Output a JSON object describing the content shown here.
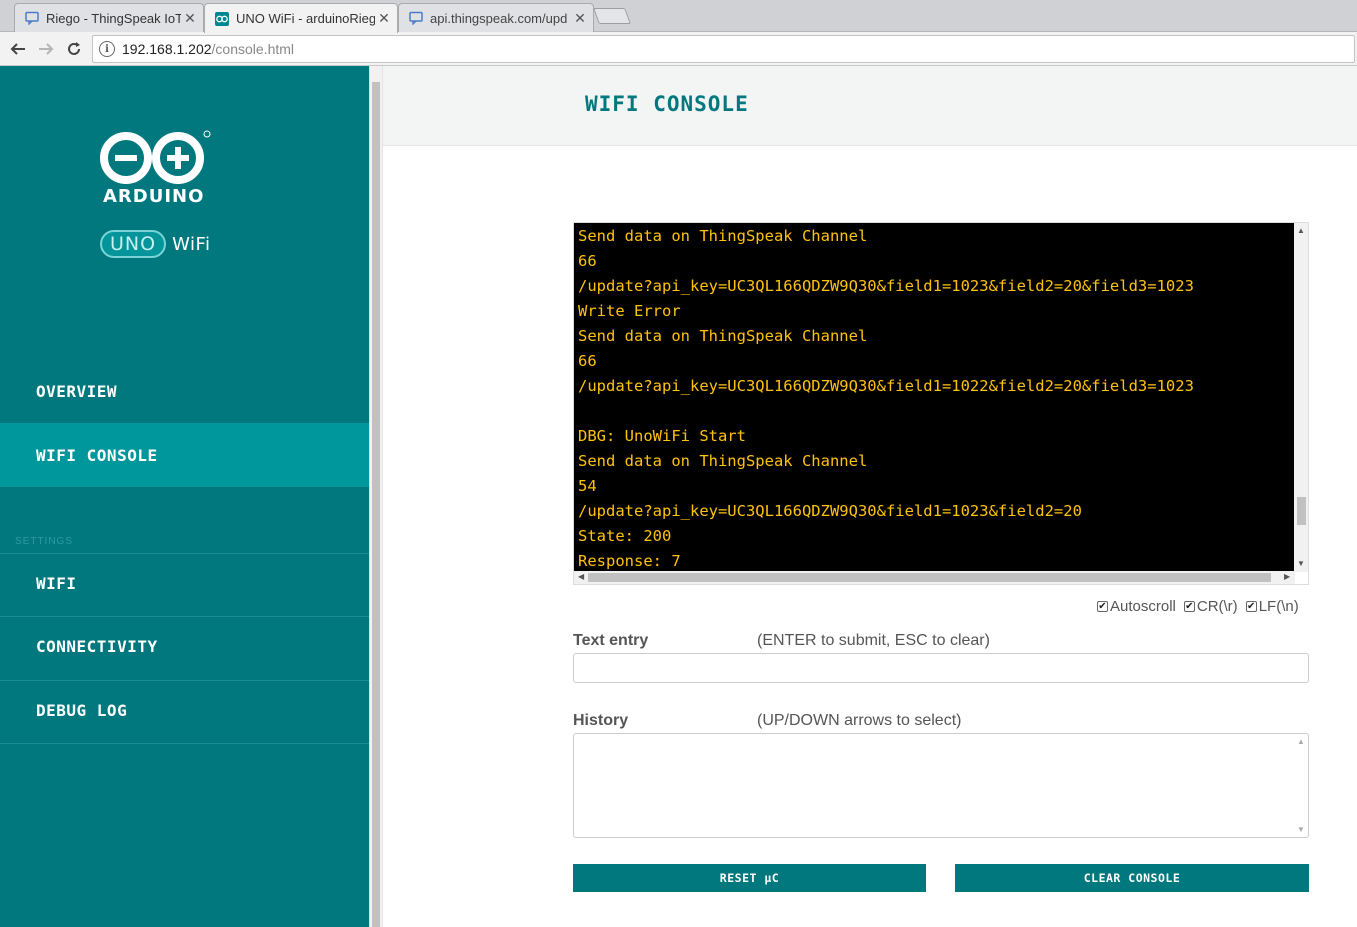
{
  "browser": {
    "tabs": [
      {
        "title": "Riego - ThingSpeak IoT",
        "icon": "chat-bubble-icon"
      },
      {
        "title": "UNO WiFi - arduinoRieg",
        "icon": "arduino-icon"
      },
      {
        "title": "api.thingspeak.com/upd",
        "icon": "chat-bubble-icon"
      }
    ],
    "address": {
      "host": "192.168.1.202",
      "path": "/console.html"
    }
  },
  "sidebar": {
    "logo_text": "ARDUINO",
    "brand_uno": "UNO",
    "brand_wifi": "WiFi",
    "items": [
      {
        "label": "OVERVIEW"
      },
      {
        "label": "WIFI CONSOLE"
      }
    ],
    "settings_label": "SETTINGS",
    "settings_items": [
      {
        "label": "WIFI"
      },
      {
        "label": "CONNECTIVITY"
      },
      {
        "label": "DEBUG LOG"
      }
    ]
  },
  "header": {
    "title": "WIFI CONSOLE"
  },
  "console": {
    "lines": [
      "Send data on ThingSpeak Channel",
      "66",
      "/update?api_key=UC3QL166QDZW9Q30&field1=1023&field2=20&field3=1023",
      "Write Error",
      "Send data on ThingSpeak Channel",
      "66",
      "/update?api_key=UC3QL166QDZW9Q30&field1=1022&field2=20&field3=1023",
      "",
      "DBG: UnoWiFi Start",
      "Send data on ThingSpeak Channel",
      "54",
      "/update?api_key=UC3QL166QDZW9Q30&field1=1023&field2=20",
      "State: 200",
      "Response: 7"
    ]
  },
  "options": {
    "autoscroll": "Autoscroll",
    "cr": "CR(\\r)",
    "lf": "LF(\\n)"
  },
  "form": {
    "text_entry_label": "Text entry",
    "text_entry_hint": "(ENTER to submit, ESC to clear)",
    "history_label": "History",
    "history_hint": "(UP/DOWN arrows to select)"
  },
  "buttons": {
    "reset": "RESET µC",
    "clear": "CLEAR CONSOLE"
  },
  "colors": {
    "teal": "#00787e",
    "teal_active": "#00979c",
    "console_text": "#ffc20e"
  }
}
